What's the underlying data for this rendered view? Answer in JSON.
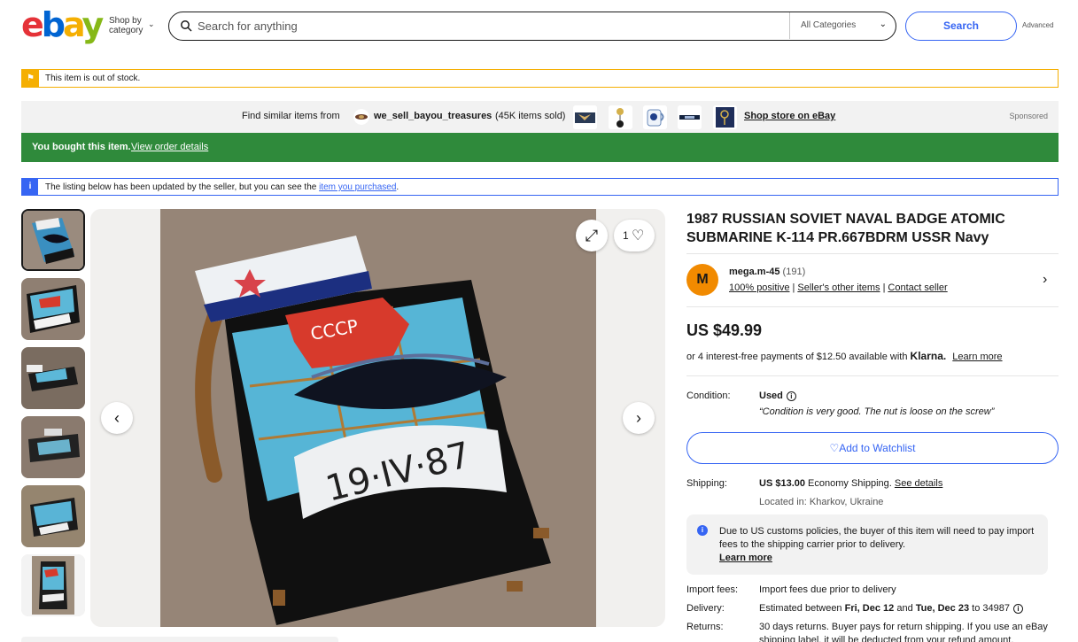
{
  "header": {
    "logo": {
      "e": "e",
      "b": "b",
      "a": "a",
      "y": "y"
    },
    "shop_by_line1": "Shop by",
    "shop_by_line2": "category",
    "search_placeholder": "Search for anything",
    "category": "All Categories",
    "search_button": "Search",
    "advanced": "Advanced"
  },
  "banners": {
    "out_of_stock": "This item is out of stock.",
    "similar_prefix": "Find similar items from",
    "seller_store": "we_sell_bayou_treasures",
    "sold_count": "(45K items sold)",
    "shop_store": "Shop store on eBay",
    "sponsored": "Sponsored",
    "bought": "You bought this item.",
    "view_order": "View order details",
    "updated_text": "The listing below has been updated by the seller, but you can see the",
    "item_link": "item you purchased",
    "updated_end": "."
  },
  "gallery": {
    "watch_count": "1",
    "thumbnail_count": 6,
    "badge_text": "19·IV·87",
    "badge_text2": "СССР"
  },
  "item": {
    "title": "1987 RUSSIAN SOVIET NAVAL BADGE ATOMIC SUBMARINE K-114 PR.667BDRM USSR Navy",
    "seller_initial": "M",
    "seller_name": "mega.m-45",
    "seller_feedback": "(191)",
    "positive": "100% positive",
    "other_items": "Seller's other items",
    "contact": "Contact seller",
    "sep": "|",
    "price": "US $49.99",
    "klarna_text": "or 4 interest-free payments of $12.50 available with",
    "klarna_brand": "Klarna.",
    "learn_more": "Learn more",
    "condition_label": "Condition:",
    "condition_value": "Used",
    "condition_note": "“Condition is very good. The nut is loose on the screw”",
    "watchlist_button": "Add to Watchlist",
    "shipping_label": "Shipping:",
    "shipping_price": "US $13.00",
    "shipping_method": "Economy Shipping.",
    "see_details": "See details",
    "located": "Located in: Kharkov, Ukraine",
    "customs_text": "Due to US customs policies, the buyer of this item will need to pay import fees to the shipping carrier prior to delivery.",
    "customs_learn": "Learn more",
    "import_label": "Import fees:",
    "import_value": "Import fees due prior to delivery",
    "delivery_label": "Delivery:",
    "delivery_prefix": "Estimated between",
    "delivery_start": "Fri, Dec 12",
    "delivery_and": "and",
    "delivery_end": "Tue, Dec 23",
    "delivery_to": "to 34987",
    "returns_label": "Returns:",
    "returns_value": "30 days returns. Buyer pays for return shipping. If you use an eBay",
    "returns_value2": "shipping label, it will be deducted from your refund amount."
  },
  "colors": {
    "accent": "#3665f3",
    "bought_green": "#2f8a3b",
    "warning": "#f5af02",
    "avatar": "#f18a00"
  }
}
